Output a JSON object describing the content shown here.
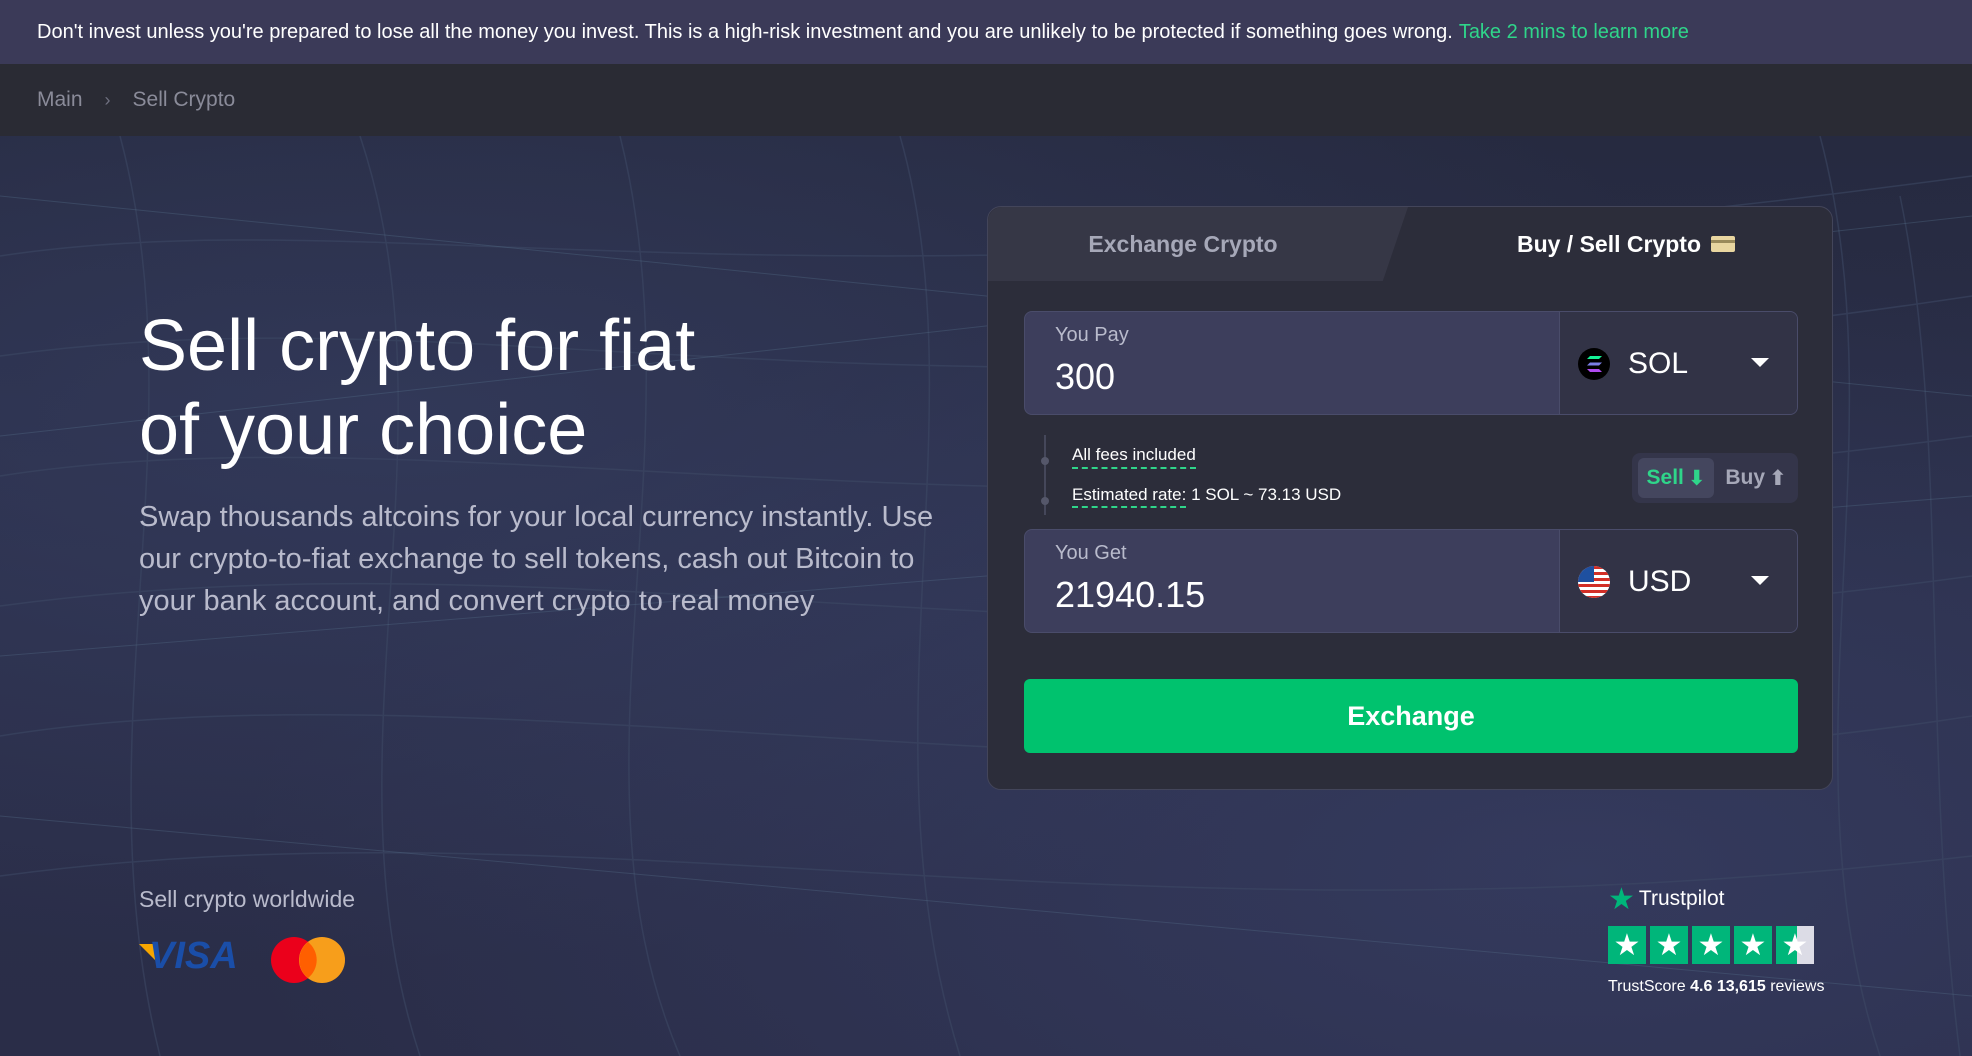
{
  "risk_banner": {
    "text": "Don't invest unless you're prepared to lose all the money you invest. This is a high-risk investment and you are unlikely to be protected if something goes wrong.",
    "link": "Take 2 mins to learn more"
  },
  "breadcrumb": {
    "items": [
      "Main",
      "Sell Crypto"
    ],
    "separator": "›"
  },
  "hero": {
    "title_line1": "Sell crypto for fiat",
    "title_line2": "of your choice",
    "subtitle": "Swap thousands altcoins for your local currency instantly. Use our crypto-to-fiat exchange to sell tokens, cash out Bitcoin to your bank account, and convert crypto to real money",
    "worldwide": "Sell crypto worldwide"
  },
  "widget": {
    "tabs": {
      "exchange": "Exchange Crypto",
      "buy_sell": "Buy / Sell Crypto"
    },
    "you_pay": {
      "label": "You Pay",
      "value": "300",
      "currency": "SOL",
      "currency_icon": "solana-icon"
    },
    "fees": "All fees included",
    "rate": {
      "label": "Estimated rate:",
      "value": "1 SOL ~ 73.13 USD"
    },
    "toggle": {
      "sell": "Sell",
      "buy": "Buy",
      "active": "sell"
    },
    "you_get": {
      "label": "You Get",
      "value": "21940.15",
      "currency": "USD",
      "currency_icon": "us-flag-icon"
    },
    "exchange_button": "Exchange"
  },
  "payment_logos": [
    "visa-logo",
    "mastercard-logo"
  ],
  "visa_text": "VISA",
  "trustpilot": {
    "brand": "Trustpilot",
    "score_label": "TrustScore",
    "score": "4.6",
    "reviews_count": "13,615",
    "reviews_label": "reviews",
    "stars": 4.5
  },
  "colors": {
    "accent": "#00c26e",
    "link_green": "#2fd58a",
    "trustpilot_green": "#00b67a",
    "banner_bg": "#3b3a58",
    "widget_bg": "#2c2d3a"
  }
}
